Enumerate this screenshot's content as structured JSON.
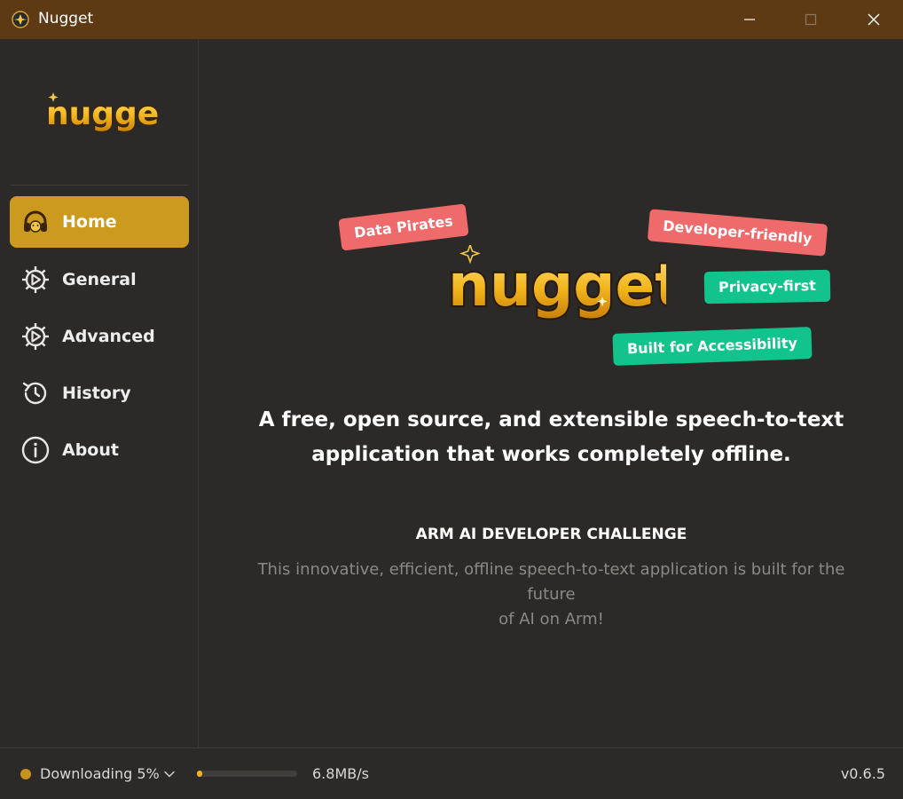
{
  "window": {
    "title": "Nugget"
  },
  "brand": {
    "logo_text": "nugget"
  },
  "sidebar": {
    "items": [
      {
        "label": "Home",
        "icon": "headphones-icon",
        "active": true
      },
      {
        "label": "General",
        "icon": "gear-icon",
        "active": false
      },
      {
        "label": "Advanced",
        "icon": "gear-icon",
        "active": false
      },
      {
        "label": "History",
        "icon": "history-icon",
        "active": false
      },
      {
        "label": "About",
        "icon": "info-icon",
        "active": false
      }
    ]
  },
  "main": {
    "tags": [
      {
        "label": "Data Pirates",
        "color": "#ef6a6a"
      },
      {
        "label": "Developer-friendly",
        "color": "#ef6a6a"
      },
      {
        "label": "Privacy-first",
        "color": "#12c48b"
      },
      {
        "label": "Built for Accessibility",
        "color": "#12c48b"
      }
    ],
    "headline_line1": "A free, open source, and extensible speech-to-text",
    "headline_line2": "application that works completely offline.",
    "challenge_title": "ARM AI DEVELOPER CHALLENGE",
    "challenge_desc_line1": "This innovative, efficient, offline speech-to-text application is built for the future",
    "challenge_desc_line2": "of AI on Arm!"
  },
  "status": {
    "download_text": "Downloading 5%",
    "progress_percent": 5,
    "speed": "6.8MB/s",
    "version": "v0.6.5"
  },
  "colors": {
    "titlebar": "#5e3a14",
    "accent": "#cc9a1e",
    "background": "#2b2a28",
    "tag_red": "#ef6a6a",
    "tag_green": "#12c48b"
  }
}
